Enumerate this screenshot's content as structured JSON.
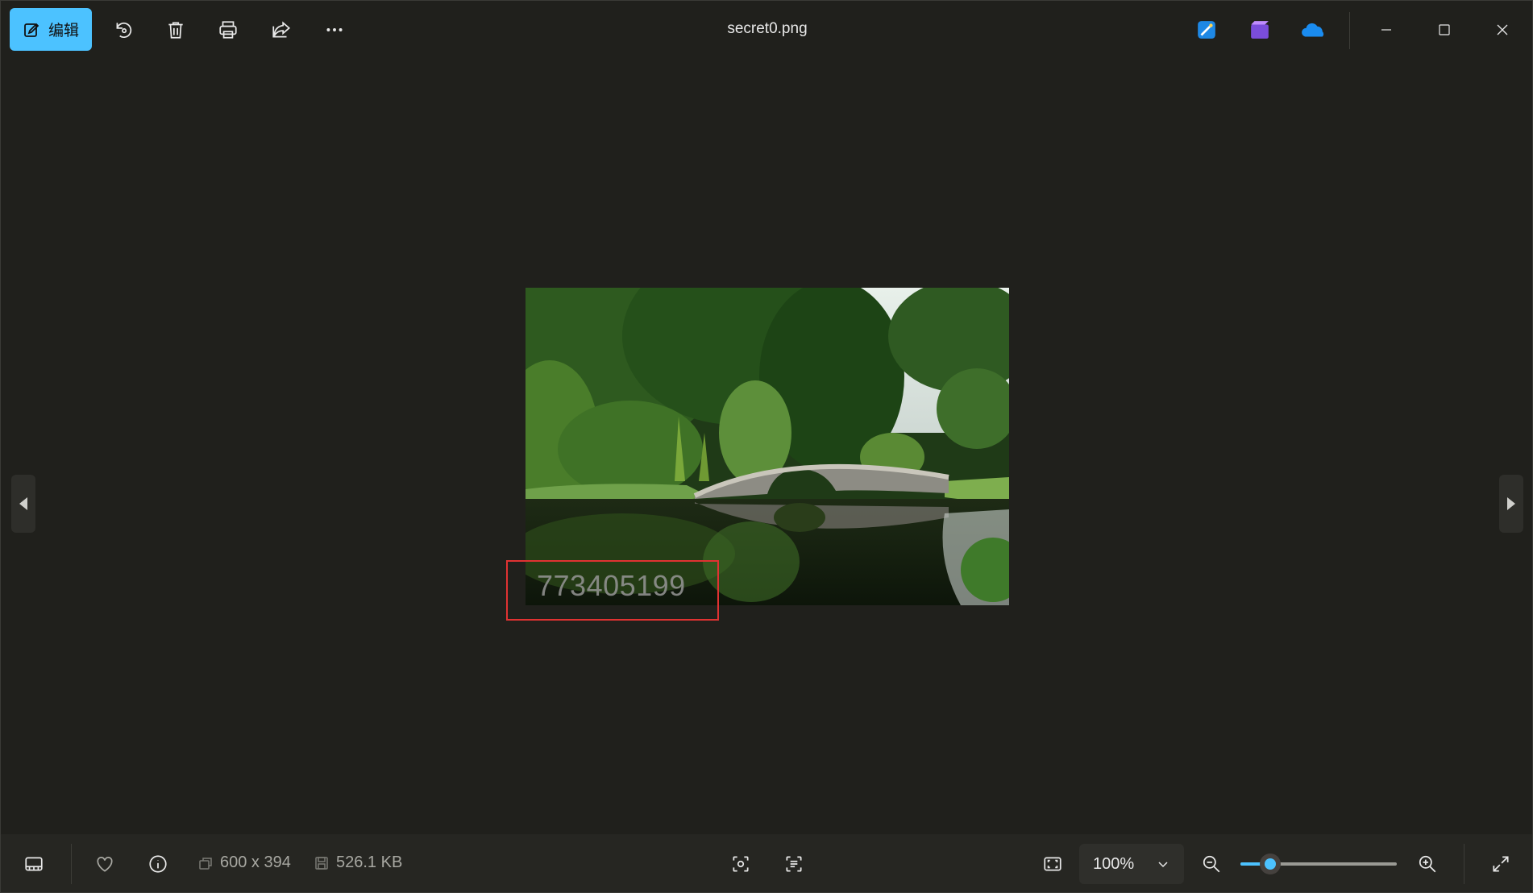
{
  "window": {
    "title": "secret0.png"
  },
  "toolbar": {
    "edit_label": "编辑",
    "icons": [
      "edit-icon",
      "rotate-icon",
      "delete-icon",
      "print-icon",
      "share-icon",
      "more-icon"
    ],
    "accent": "#4cc2ff"
  },
  "apps": [
    "designer-icon",
    "clipchamp-icon",
    "onedrive-icon"
  ],
  "window_controls": [
    "minimize-icon",
    "maximize-icon",
    "close-icon"
  ],
  "image": {
    "overlay_text": "773405199",
    "highlight_color": "#e03232"
  },
  "statusbar": {
    "dimensions": "600 x 394",
    "file_size": "526.1 KB",
    "zoom": "100%",
    "zoom_slider_fraction": 0.19
  }
}
